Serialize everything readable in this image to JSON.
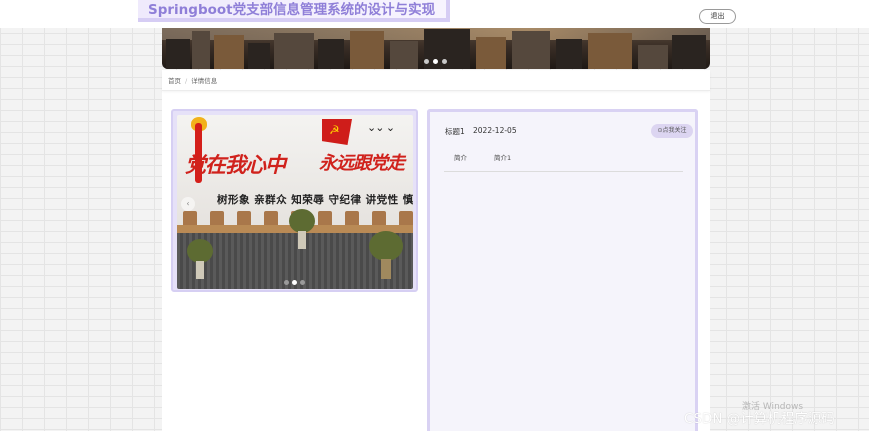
{
  "header": {
    "site_title": "Springboot党支部信息管理系统的设计与实现",
    "logout_label": "退出"
  },
  "breadcrumb": {
    "home": "首页",
    "current": "详情信息"
  },
  "carousel": {
    "slogan_left": "党在我心中",
    "slogan_right": "永远跟党走",
    "subline": "树形象 亲群众 知荣辱 守纪律 讲党性 慎言行",
    "prev_glyph": "‹",
    "dot_count": 3,
    "active_dot": 2
  },
  "detail": {
    "title": "标题1",
    "date": "2022-12-05",
    "follow_label": "⊙点我关注",
    "tabs": [
      {
        "label": "简介"
      },
      {
        "label": "简介1"
      }
    ]
  },
  "overlay": {
    "activation_watermark": "激活 Windows",
    "csdn_watermark": "CSDN @计算机程序源码"
  },
  "colors": {
    "accent": "#8f7fd8",
    "accent_border": "#d6cdf4",
    "party_red": "#d0221c"
  }
}
